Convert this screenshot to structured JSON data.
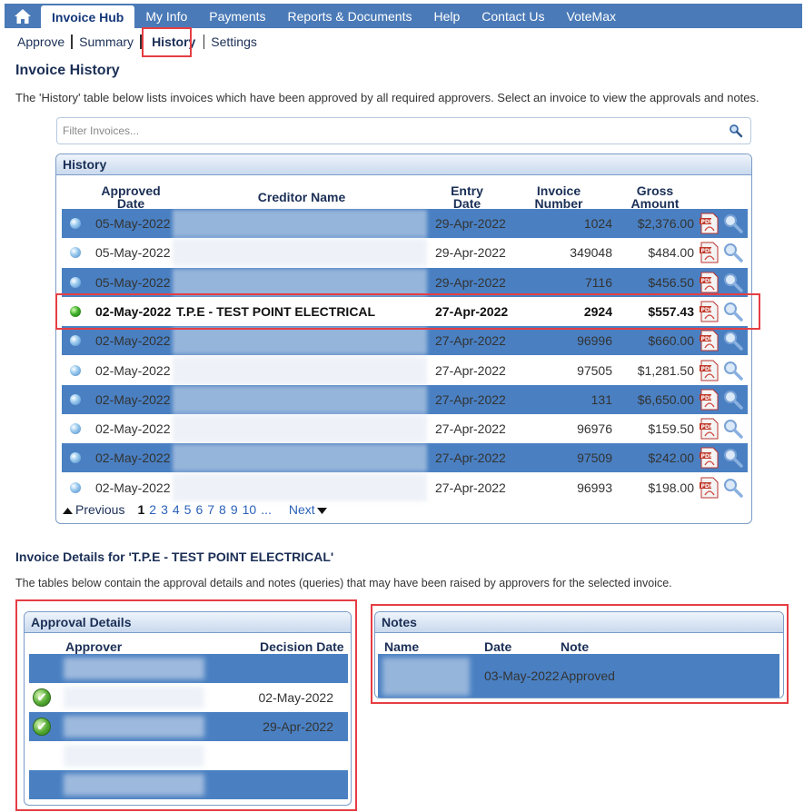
{
  "nav": {
    "tabs": [
      {
        "label": "Invoice Hub"
      },
      {
        "label": "My Info"
      },
      {
        "label": "Payments"
      },
      {
        "label": "Reports & Documents"
      },
      {
        "label": "Help"
      },
      {
        "label": "Contact Us"
      },
      {
        "label": "VoteMax"
      }
    ],
    "active_index": 0,
    "home_icon": "home-icon"
  },
  "subnav": {
    "items": [
      {
        "label": "Approve"
      },
      {
        "label": "Summary"
      },
      {
        "label": "History"
      },
      {
        "label": "Settings"
      }
    ],
    "active_index": 2
  },
  "page": {
    "title": "Invoice History",
    "description": "The 'History' table below lists invoices which have been approved by all required approvers. Select an invoice to view the approvals and notes."
  },
  "filter": {
    "placeholder": "Filter Invoices...",
    "value": "",
    "icon": "search-icon"
  },
  "history": {
    "title": "History",
    "columns": [
      {
        "label": "Approved\nDate"
      },
      {
        "label": "Creditor Name"
      },
      {
        "label": "Entry\nDate"
      },
      {
        "label": "Invoice\nNumber"
      },
      {
        "label": "Gross\nAmount"
      }
    ],
    "rows": [
      {
        "approved": "05-May-2022",
        "creditor": "",
        "entry": "29-Apr-2022",
        "number": "1024",
        "amount": "$2,376.00",
        "selected": false
      },
      {
        "approved": "05-May-2022",
        "creditor": "",
        "entry": "29-Apr-2022",
        "number": "349048",
        "amount": "$484.00",
        "selected": false
      },
      {
        "approved": "05-May-2022",
        "creditor": "",
        "entry": "29-Apr-2022",
        "number": "7116",
        "amount": "$456.50",
        "selected": false
      },
      {
        "approved": "02-May-2022",
        "creditor": "T.P.E - TEST POINT ELECTRICAL",
        "entry": "27-Apr-2022",
        "number": "2924",
        "amount": "$557.43",
        "selected": true
      },
      {
        "approved": "02-May-2022",
        "creditor": "",
        "entry": "27-Apr-2022",
        "number": "96996",
        "amount": "$660.00",
        "selected": false
      },
      {
        "approved": "02-May-2022",
        "creditor": "",
        "entry": "27-Apr-2022",
        "number": "97505",
        "amount": "$1,281.50",
        "selected": false
      },
      {
        "approved": "02-May-2022",
        "creditor": "",
        "entry": "27-Apr-2022",
        "number": "131",
        "amount": "$6,650.00",
        "selected": false
      },
      {
        "approved": "02-May-2022",
        "creditor": "",
        "entry": "27-Apr-2022",
        "number": "96976",
        "amount": "$159.50",
        "selected": false
      },
      {
        "approved": "02-May-2022",
        "creditor": "",
        "entry": "27-Apr-2022",
        "number": "97509",
        "amount": "$242.00",
        "selected": false
      },
      {
        "approved": "02-May-2022",
        "creditor": "",
        "entry": "27-Apr-2022",
        "number": "96993",
        "amount": "$198.00",
        "selected": false
      }
    ],
    "pagination": {
      "previous": "Previous",
      "next": "Next",
      "pages": [
        "1",
        "2",
        "3",
        "4",
        "5",
        "6",
        "7",
        "8",
        "9",
        "10",
        "..."
      ],
      "current": "1"
    }
  },
  "details": {
    "title": "Invoice Details for 'T.P.E - TEST POINT ELECTRICAL'",
    "description": "The tables below contain the approval details and notes (queries) that may have been raised by approvers for the selected invoice."
  },
  "approval": {
    "title": "Approval Details",
    "columns": [
      {
        "label": "Approver"
      },
      {
        "label": "Decision Date"
      }
    ],
    "rows": [
      {
        "approver": "",
        "decision_date": "",
        "approved": false
      },
      {
        "approver": "",
        "decision_date": "02-May-2022",
        "approved": true
      },
      {
        "approver": "",
        "decision_date": "29-Apr-2022",
        "approved": true
      },
      {
        "approver": "",
        "decision_date": "",
        "approved": false
      },
      {
        "approver": "",
        "decision_date": "",
        "approved": false
      }
    ]
  },
  "notes": {
    "title": "Notes",
    "columns": [
      {
        "label": "Name"
      },
      {
        "label": "Date"
      },
      {
        "label": "Note"
      }
    ],
    "rows": [
      {
        "name": "",
        "date": "03-May-2022",
        "note": "Approved"
      }
    ]
  },
  "colors": {
    "nav_bg": "#4a7ab7",
    "row_alt": "#4a80c2",
    "highlight_frame": "#e53e44",
    "heading": "#1b2f56"
  }
}
